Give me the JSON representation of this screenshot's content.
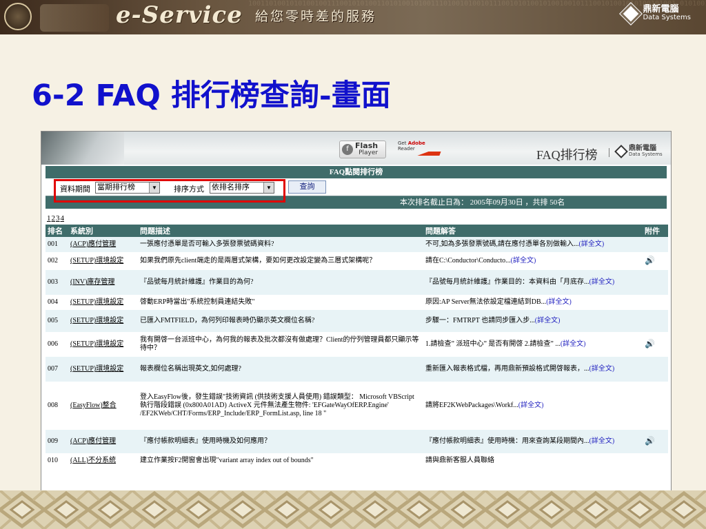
{
  "banner": {
    "binary_text": "1001101001010100100111001010100110101001010011101001010010111001010100101001001011100101001010100101001 0101001010010101110010100101010010100101001010010100101010010100101001010010101110010100101001010",
    "logo": "e-Service",
    "slogan": "給您零時差的服務",
    "brand_zh": "鼎新電腦",
    "brand_en": "Data Systems"
  },
  "slide_title": {
    "prefix": "6-2 FAQ ",
    "zh": "排行榜查詢-畫面"
  },
  "app_header": {
    "flash_line1": "Flash",
    "flash_line2": "Player",
    "reader_get": "Get",
    "reader_adobe": "Adobe",
    "reader_reader": "Reader",
    "faq_title": "FAQ排行榜",
    "separator": "|",
    "brand_zh": "鼎新電腦",
    "brand_en": "Data Systems"
  },
  "rank_bar": "FAQ點閱排行榜",
  "filter": {
    "period_label": "資料期間",
    "period_value": "當期排行榜",
    "sort_label": "排序方式",
    "sort_value": "依排名排序",
    "query_button": "查詢"
  },
  "summary": "本次排名截止日為： 2005年09月30日 ，共排 50名",
  "pager": [
    "1",
    "2",
    "3",
    "4"
  ],
  "table": {
    "headers": [
      "排名",
      "系統別",
      "問題描述",
      "問題解答",
      "附件"
    ],
    "rows": [
      {
        "rank": "001",
        "category": "(ACP)應付管理",
        "question": "一張應付憑單是否可輸入多張發票號碼資料?",
        "answer": "不可,如為多張發票號碼,請在應付憑單各別做輸入...",
        "more": "(詳全文)",
        "attach": ""
      },
      {
        "rank": "002",
        "category": "(SETUP)環境設定",
        "question": "如果我們原先client端走的是兩層式架構，要如何更改設定變為三層式架構呢？",
        "answer": "請在C:\\Conductor\\Conducto...",
        "more": "(詳全文)",
        "attach": "🔊"
      },
      {
        "rank": "003",
        "category": "(INV)庫存管理",
        "question": "『品號每月統計維護』作業目的為何?",
        "answer": "『品號每月統計維護』作業目的：本資料由「月底存...",
        "more": "(詳全文)",
        "attach": ""
      },
      {
        "rank": "004",
        "category": "(SETUP)環境設定",
        "question": "啓動ERP時當出\"系統控制員連結失敗\"",
        "answer": "原因:AP Server無法依設定檔連結到DB...",
        "more": "(詳全文)",
        "attach": ""
      },
      {
        "rank": "005",
        "category": "(SETUP)環境設定",
        "question": "已匯入FMTFIELD，為何列印報表時仍顯示英文欄位名稱?",
        "answer": "步驟一：FMTRPT 也請同步匯入步...",
        "more": "(詳全文)",
        "attach": ""
      },
      {
        "rank": "006",
        "category": "(SETUP)環境設定",
        "question": "我有開啓一台派班中心，為何我的報表及批次都沒有做處理？Client的佇列管理員都只顯示等待中？",
        "answer": "1.請檢查” 派班中心” 是否有開啓 2.請檢查” ...",
        "more": "(詳全文)",
        "attach": "🔊"
      },
      {
        "rank": "007",
        "category": "(SETUP)環境設定",
        "question": "報表欄位名稱出現英文,如何處理?",
        "answer": "重新匯入報表格式檔，再用鼎新預設格式開啓報表，...",
        "more": "(詳全文)",
        "attach": ""
      },
      {
        "rank": "008",
        "category": "(EasyFlow)整合",
        "question": "登入EasyFlow後，發生錯誤\"技術資訊 (供技術支援人員使用) 錯誤類型： Microsoft VBScript 執行階段錯誤 (0x800A01AD) ActiveX 元件無法產生物件: 'EFGateWayOfERP.Engine' /EF2KWeb/CHT/Forms/ERP_Include/ERP_FormList.asp, line 18 \"",
        "answer": "請將EF2KWebPackages\\Workf...",
        "more": "(詳全文)",
        "attach": ""
      },
      {
        "rank": "009",
        "category": "(ACP)應付管理",
        "question": "『應付帳款明細表』使用時機及如何應用？",
        "answer": "『應付帳款明細表』使用時機：用來查詢某段期間內...",
        "more": "(詳全文)",
        "attach": "🔊"
      },
      {
        "rank": "010",
        "category": "(ALL)不分系統",
        "question": "建立作業按F2開窗會出現\"variant array index out of bounds\"",
        "answer": "請與鼎新客服人員聯絡",
        "more": "",
        "attach": ""
      }
    ]
  }
}
